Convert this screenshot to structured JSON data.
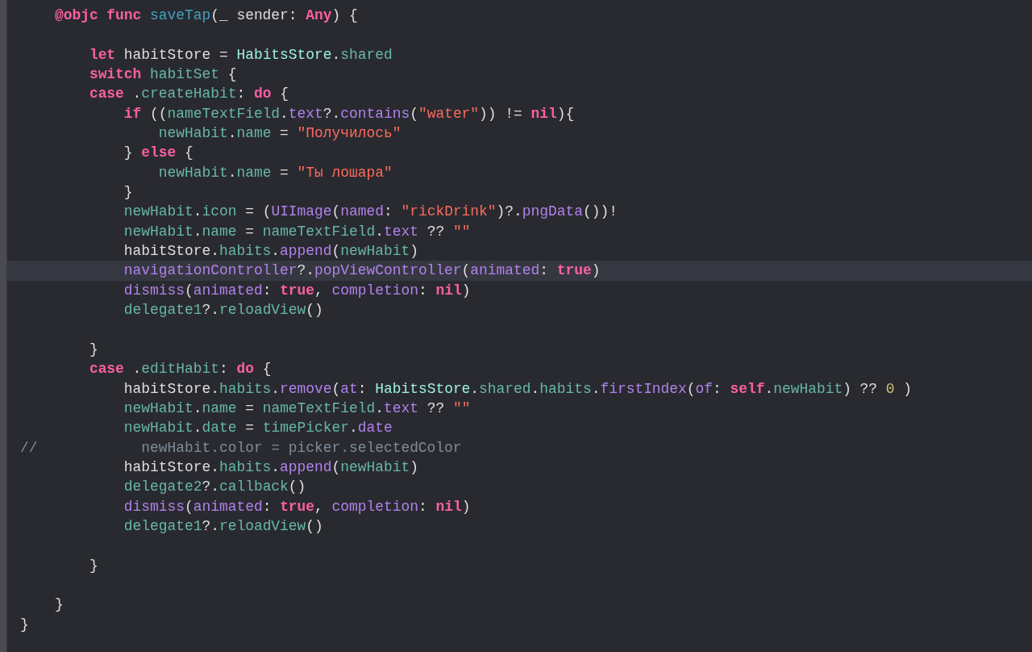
{
  "editor": {
    "lines": [
      {
        "kind": "code",
        "current": false,
        "tokens": [
          {
            "text": "    @objc func",
            "kind": "keyword"
          },
          {
            "text": " saveTap",
            "kind": "declaration"
          },
          {
            "text": "(_ sender: ",
            "kind": "plain"
          },
          {
            "text": "Any",
            "kind": "keyword"
          },
          {
            "text": ") {",
            "kind": "plain"
          }
        ]
      },
      {
        "kind": "blank",
        "current": false
      },
      {
        "kind": "code",
        "current": false,
        "tokens": [
          {
            "text": "        let",
            "kind": "keyword"
          },
          {
            "text": " habitStore = ",
            "kind": "plain"
          },
          {
            "text": "HabitsStore",
            "kind": "type"
          },
          {
            "text": ".",
            "kind": "plain"
          },
          {
            "text": "shared",
            "kind": "project"
          }
        ]
      },
      {
        "kind": "code",
        "current": false,
        "tokens": [
          {
            "text": "        switch",
            "kind": "keyword"
          },
          {
            "text": " habitSet",
            "kind": "project"
          },
          {
            "text": " {",
            "kind": "plain"
          }
        ]
      },
      {
        "kind": "code",
        "current": false,
        "tokens": [
          {
            "text": "        case",
            "kind": "keyword"
          },
          {
            "text": " .",
            "kind": "plain"
          },
          {
            "text": "createHabit",
            "kind": "project"
          },
          {
            "text": ": ",
            "kind": "plain"
          },
          {
            "text": "do",
            "kind": "keyword"
          },
          {
            "text": " {",
            "kind": "plain"
          }
        ]
      },
      {
        "kind": "code",
        "current": false,
        "tokens": [
          {
            "text": "            if",
            "kind": "keyword"
          },
          {
            "text": " ((",
            "kind": "plain"
          },
          {
            "text": "nameTextField",
            "kind": "project"
          },
          {
            "text": ".",
            "kind": "plain"
          },
          {
            "text": "text",
            "kind": "system"
          },
          {
            "text": "?.",
            "kind": "plain"
          },
          {
            "text": "contains",
            "kind": "system"
          },
          {
            "text": "(",
            "kind": "plain"
          },
          {
            "text": "\"water\"",
            "kind": "string"
          },
          {
            "text": ")) != ",
            "kind": "plain"
          },
          {
            "text": "nil",
            "kind": "keyword"
          },
          {
            "text": "){",
            "kind": "plain"
          }
        ]
      },
      {
        "kind": "code",
        "current": false,
        "tokens": [
          {
            "text": "                newHabit",
            "kind": "project"
          },
          {
            "text": ".",
            "kind": "plain"
          },
          {
            "text": "name",
            "kind": "project"
          },
          {
            "text": " = ",
            "kind": "plain"
          },
          {
            "text": "\"Получилось\"",
            "kind": "string"
          }
        ]
      },
      {
        "kind": "code",
        "current": false,
        "tokens": [
          {
            "text": "            } ",
            "kind": "plain"
          },
          {
            "text": "else",
            "kind": "keyword"
          },
          {
            "text": " {",
            "kind": "plain"
          }
        ]
      },
      {
        "kind": "code",
        "current": false,
        "tokens": [
          {
            "text": "                newHabit",
            "kind": "project"
          },
          {
            "text": ".",
            "kind": "plain"
          },
          {
            "text": "name",
            "kind": "project"
          },
          {
            "text": " = ",
            "kind": "plain"
          },
          {
            "text": "\"Ты лошара\"",
            "kind": "string"
          }
        ]
      },
      {
        "kind": "code",
        "current": false,
        "tokens": [
          {
            "text": "            }",
            "kind": "plain"
          }
        ]
      },
      {
        "kind": "code",
        "current": false,
        "tokens": [
          {
            "text": "            newHabit",
            "kind": "project"
          },
          {
            "text": ".",
            "kind": "plain"
          },
          {
            "text": "icon",
            "kind": "project"
          },
          {
            "text": " = (",
            "kind": "plain"
          },
          {
            "text": "UIImage",
            "kind": "system"
          },
          {
            "text": "(",
            "kind": "plain"
          },
          {
            "text": "named",
            "kind": "system"
          },
          {
            "text": ": ",
            "kind": "plain"
          },
          {
            "text": "\"rickDrink\"",
            "kind": "string"
          },
          {
            "text": ")?.",
            "kind": "plain"
          },
          {
            "text": "pngData",
            "kind": "system"
          },
          {
            "text": "())!",
            "kind": "plain"
          }
        ]
      },
      {
        "kind": "code",
        "current": false,
        "tokens": [
          {
            "text": "            newHabit",
            "kind": "project"
          },
          {
            "text": ".",
            "kind": "plain"
          },
          {
            "text": "name",
            "kind": "project"
          },
          {
            "text": " = ",
            "kind": "plain"
          },
          {
            "text": "nameTextField",
            "kind": "project"
          },
          {
            "text": ".",
            "kind": "plain"
          },
          {
            "text": "text",
            "kind": "system"
          },
          {
            "text": " ?? ",
            "kind": "plain"
          },
          {
            "text": "\"\"",
            "kind": "string"
          }
        ]
      },
      {
        "kind": "code",
        "current": false,
        "tokens": [
          {
            "text": "            habitStore.",
            "kind": "plain"
          },
          {
            "text": "habits",
            "kind": "project"
          },
          {
            "text": ".",
            "kind": "plain"
          },
          {
            "text": "append",
            "kind": "system"
          },
          {
            "text": "(",
            "kind": "plain"
          },
          {
            "text": "newHabit",
            "kind": "project"
          },
          {
            "text": ")",
            "kind": "plain"
          }
        ]
      },
      {
        "kind": "code",
        "current": true,
        "tokens": [
          {
            "text": "            navigationController",
            "kind": "system"
          },
          {
            "text": "?.",
            "kind": "plain"
          },
          {
            "text": "popViewController",
            "kind": "system"
          },
          {
            "text": "(",
            "kind": "plain"
          },
          {
            "text": "animated",
            "kind": "system"
          },
          {
            "text": ": ",
            "kind": "plain"
          },
          {
            "text": "true",
            "kind": "keyword"
          },
          {
            "text": ")",
            "kind": "plain"
          }
        ]
      },
      {
        "kind": "code",
        "current": false,
        "tokens": [
          {
            "text": "            dismiss",
            "kind": "system"
          },
          {
            "text": "(",
            "kind": "plain"
          },
          {
            "text": "animated",
            "kind": "system"
          },
          {
            "text": ": ",
            "kind": "plain"
          },
          {
            "text": "true",
            "kind": "keyword"
          },
          {
            "text": ", ",
            "kind": "plain"
          },
          {
            "text": "completion",
            "kind": "system"
          },
          {
            "text": ": ",
            "kind": "plain"
          },
          {
            "text": "nil",
            "kind": "keyword"
          },
          {
            "text": ")",
            "kind": "plain"
          }
        ]
      },
      {
        "kind": "code",
        "current": false,
        "tokens": [
          {
            "text": "            delegate1",
            "kind": "project"
          },
          {
            "text": "?.",
            "kind": "plain"
          },
          {
            "text": "reloadView",
            "kind": "project"
          },
          {
            "text": "()",
            "kind": "plain"
          }
        ]
      },
      {
        "kind": "blank",
        "current": false
      },
      {
        "kind": "code",
        "current": false,
        "tokens": [
          {
            "text": "        }",
            "kind": "plain"
          }
        ]
      },
      {
        "kind": "code",
        "current": false,
        "tokens": [
          {
            "text": "        case",
            "kind": "keyword"
          },
          {
            "text": " .",
            "kind": "plain"
          },
          {
            "text": "editHabit",
            "kind": "project"
          },
          {
            "text": ": ",
            "kind": "plain"
          },
          {
            "text": "do",
            "kind": "keyword"
          },
          {
            "text": " {",
            "kind": "plain"
          }
        ]
      },
      {
        "kind": "code",
        "current": false,
        "tokens": [
          {
            "text": "            habitStore.",
            "kind": "plain"
          },
          {
            "text": "habits",
            "kind": "project"
          },
          {
            "text": ".",
            "kind": "plain"
          },
          {
            "text": "remove",
            "kind": "system"
          },
          {
            "text": "(",
            "kind": "plain"
          },
          {
            "text": "at",
            "kind": "system"
          },
          {
            "text": ": ",
            "kind": "plain"
          },
          {
            "text": "HabitsStore",
            "kind": "type"
          },
          {
            "text": ".",
            "kind": "plain"
          },
          {
            "text": "shared",
            "kind": "project"
          },
          {
            "text": ".",
            "kind": "plain"
          },
          {
            "text": "habits",
            "kind": "project"
          },
          {
            "text": ".",
            "kind": "plain"
          },
          {
            "text": "firstIndex",
            "kind": "system"
          },
          {
            "text": "(",
            "kind": "plain"
          },
          {
            "text": "of",
            "kind": "system"
          },
          {
            "text": ": ",
            "kind": "plain"
          },
          {
            "text": "self",
            "kind": "keyword"
          },
          {
            "text": ".",
            "kind": "plain"
          },
          {
            "text": "newHabit",
            "kind": "project"
          },
          {
            "text": ") ?? ",
            "kind": "plain"
          },
          {
            "text": "0",
            "kind": "number"
          },
          {
            "text": " )",
            "kind": "plain"
          }
        ]
      },
      {
        "kind": "code",
        "current": false,
        "tokens": [
          {
            "text": "            newHabit",
            "kind": "project"
          },
          {
            "text": ".",
            "kind": "plain"
          },
          {
            "text": "name",
            "kind": "project"
          },
          {
            "text": " = ",
            "kind": "plain"
          },
          {
            "text": "nameTextField",
            "kind": "project"
          },
          {
            "text": ".",
            "kind": "plain"
          },
          {
            "text": "text",
            "kind": "system"
          },
          {
            "text": " ?? ",
            "kind": "plain"
          },
          {
            "text": "\"\"",
            "kind": "string"
          }
        ]
      },
      {
        "kind": "code",
        "current": false,
        "tokens": [
          {
            "text": "            newHabit",
            "kind": "project"
          },
          {
            "text": ".",
            "kind": "plain"
          },
          {
            "text": "date",
            "kind": "project"
          },
          {
            "text": " = ",
            "kind": "plain"
          },
          {
            "text": "timePicker",
            "kind": "project"
          },
          {
            "text": ".",
            "kind": "plain"
          },
          {
            "text": "date",
            "kind": "system"
          }
        ]
      },
      {
        "kind": "code",
        "current": false,
        "tokens": [
          {
            "text": "//            newHabit.color = picker.selectedColor",
            "kind": "comment"
          }
        ]
      },
      {
        "kind": "code",
        "current": false,
        "tokens": [
          {
            "text": "            habitStore.",
            "kind": "plain"
          },
          {
            "text": "habits",
            "kind": "project"
          },
          {
            "text": ".",
            "kind": "plain"
          },
          {
            "text": "append",
            "kind": "system"
          },
          {
            "text": "(",
            "kind": "plain"
          },
          {
            "text": "newHabit",
            "kind": "project"
          },
          {
            "text": ")",
            "kind": "plain"
          }
        ]
      },
      {
        "kind": "code",
        "current": false,
        "tokens": [
          {
            "text": "            delegate2",
            "kind": "project"
          },
          {
            "text": "?.",
            "kind": "plain"
          },
          {
            "text": "callback",
            "kind": "project"
          },
          {
            "text": "()",
            "kind": "plain"
          }
        ]
      },
      {
        "kind": "code",
        "current": false,
        "tokens": [
          {
            "text": "            dismiss",
            "kind": "system"
          },
          {
            "text": "(",
            "kind": "plain"
          },
          {
            "text": "animated",
            "kind": "system"
          },
          {
            "text": ": ",
            "kind": "plain"
          },
          {
            "text": "true",
            "kind": "keyword"
          },
          {
            "text": ", ",
            "kind": "plain"
          },
          {
            "text": "completion",
            "kind": "system"
          },
          {
            "text": ": ",
            "kind": "plain"
          },
          {
            "text": "nil",
            "kind": "keyword"
          },
          {
            "text": ")",
            "kind": "plain"
          }
        ]
      },
      {
        "kind": "code",
        "current": false,
        "tokens": [
          {
            "text": "            delegate1",
            "kind": "project"
          },
          {
            "text": "?.",
            "kind": "plain"
          },
          {
            "text": "reloadView",
            "kind": "project"
          },
          {
            "text": "()",
            "kind": "plain"
          }
        ]
      },
      {
        "kind": "blank",
        "current": false
      },
      {
        "kind": "code",
        "current": false,
        "tokens": [
          {
            "text": "        }",
            "kind": "plain"
          }
        ]
      },
      {
        "kind": "blank",
        "current": false
      },
      {
        "kind": "code",
        "current": false,
        "tokens": [
          {
            "text": "    }",
            "kind": "plain"
          }
        ]
      },
      {
        "kind": "code",
        "current": false,
        "tokens": [
          {
            "text": "}",
            "kind": "plain"
          }
        ]
      }
    ]
  }
}
